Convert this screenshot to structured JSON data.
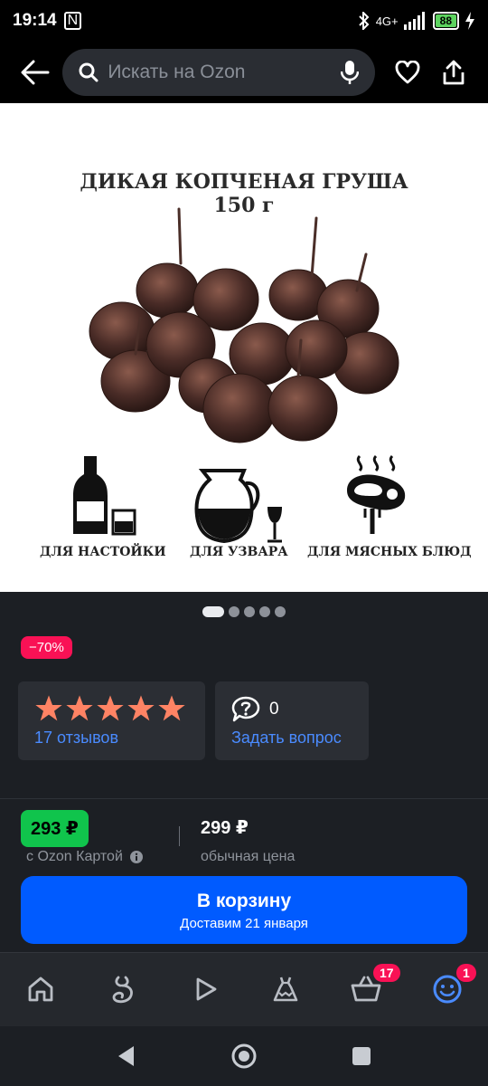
{
  "status_bar": {
    "time": "19:14",
    "network": "4G+",
    "battery": "88"
  },
  "search": {
    "placeholder": "Искать на Ozon"
  },
  "product_image": {
    "title_line1": "ДИКАЯ КОПЧЕНАЯ ГРУША",
    "title_line2": "150 г",
    "captions": [
      "ДЛЯ НАСТОЙКИ",
      "ДЛЯ УЗВАРА",
      "ДЛЯ МЯСНЫХ БЛЮД"
    ]
  },
  "carousel": {
    "total": 5,
    "active_index": 0
  },
  "discount_badge": "−70%",
  "rating": {
    "stars": 5,
    "reviews_label": "17 отзывов"
  },
  "questions": {
    "count": "0",
    "ask_label": "Задать вопрос"
  },
  "price": {
    "ozon_card_price": "293 ₽",
    "ozon_card_label": "с Ozon Картой",
    "regular_price": "299 ₽",
    "regular_label": "обычная цена"
  },
  "cart_button": {
    "label": "В корзину",
    "delivery": "Доставим 21 января"
  },
  "bottom_nav": {
    "cart_badge": "17",
    "profile_badge": "1"
  },
  "colors": {
    "accent_blue": "#005bff",
    "discount_red": "#f91155",
    "price_green": "#10c44c",
    "star": "#ff8364"
  }
}
